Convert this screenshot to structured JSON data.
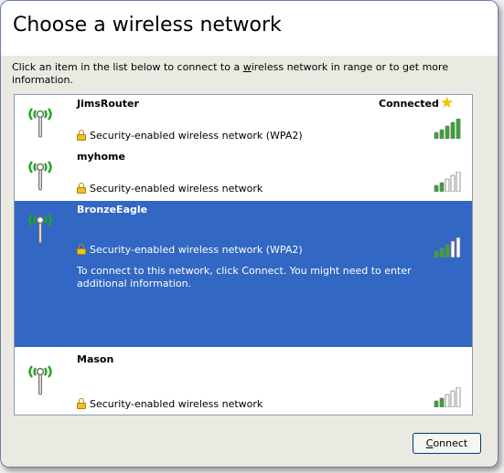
{
  "dialog": {
    "title": "Choose a wireless network",
    "description_pre": "Click an item in the list below to connect to a ",
    "description_access": "w",
    "description_post": "ireless network in range or to get more information."
  },
  "networks": [
    {
      "name": "JimsRouter",
      "security": "Security-enabled wireless network (WPA2)",
      "status": "Connected",
      "signal_bars": 5,
      "selected": false
    },
    {
      "name": "myhome",
      "security": "Security-enabled wireless network",
      "signal_bars": 2,
      "selected": false
    },
    {
      "name": "BronzeEagle",
      "security": "Security-enabled wireless network (WPA2)",
      "hint": "To connect to this network, click Connect. You might need to enter additional information.",
      "signal_bars": 3,
      "selected": true
    },
    {
      "name": "Mason",
      "security": "Security-enabled wireless network",
      "signal_bars": 2,
      "selected": false
    }
  ],
  "buttons": {
    "connect_access": "C",
    "connect_rest": "onnect"
  },
  "icons": {
    "antenna": "wireless-antenna-icon",
    "lock": "lock-icon",
    "star": "star-icon",
    "signal": "signal-strength-icon"
  },
  "colors": {
    "selection": "#3267c3",
    "signal_on": "#2fa82f",
    "signal_off": "#ffffff",
    "antenna_waves": "#21a521",
    "star": "#f2c200"
  }
}
